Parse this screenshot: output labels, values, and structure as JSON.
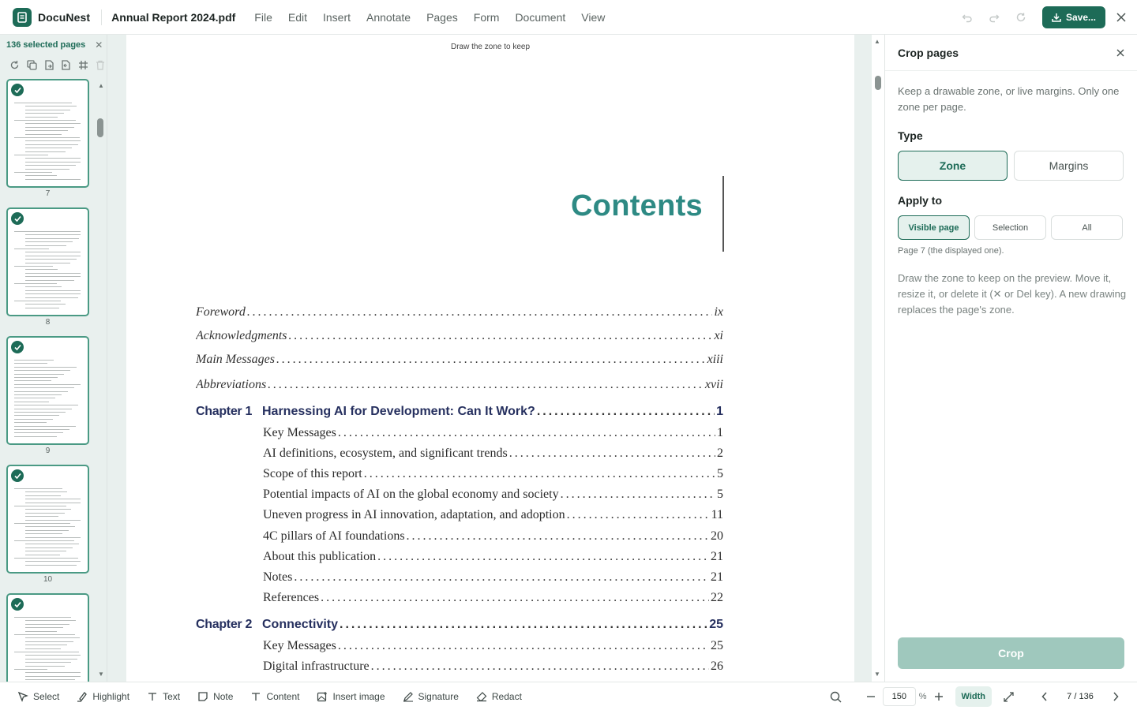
{
  "app": {
    "name": "DocuNest",
    "filename": "Annual Report 2024.pdf"
  },
  "menu": [
    "File",
    "Edit",
    "Insert",
    "Annotate",
    "Pages",
    "Form",
    "Document",
    "View"
  ],
  "toolbar": {
    "save_label": "Save..."
  },
  "sidebar": {
    "selected_label": "136 selected pages",
    "thumbnails": [
      {
        "page": "7"
      },
      {
        "page": "8"
      },
      {
        "page": "9"
      },
      {
        "page": "10"
      },
      {
        "page": ""
      }
    ]
  },
  "document": {
    "zone_hint": "Draw the zone to keep",
    "title": "Contents",
    "front_matter": [
      {
        "label": "Foreword",
        "page": "ix"
      },
      {
        "label": "Acknowledgments",
        "page": "xi"
      },
      {
        "label": "Main Messages",
        "page": "xiii"
      },
      {
        "label": "Abbreviations",
        "page": "xvii"
      }
    ],
    "chapters": [
      {
        "number": "Chapter 1",
        "title": "Harnessing AI for Development: Can It Work?",
        "page": "1",
        "sections": [
          {
            "label": "Key Messages",
            "page": "1"
          },
          {
            "label": "AI definitions, ecosystem, and significant trends",
            "page": "2"
          },
          {
            "label": "Scope of this report",
            "page": "5"
          },
          {
            "label": "Potential impacts of AI on the global economy and society",
            "page": "5"
          },
          {
            "label": "Uneven progress in AI innovation, adaptation, and adoption",
            "page": "11"
          },
          {
            "label": "4C pillars of AI foundations",
            "page": "20"
          },
          {
            "label": "About this publication",
            "page": "21"
          },
          {
            "label": "Notes",
            "page": "21"
          },
          {
            "label": "References",
            "page": "22"
          }
        ]
      },
      {
        "number": "Chapter 2",
        "title": "Connectivity",
        "page": "25",
        "sections": [
          {
            "label": "Key Messages",
            "page": "25"
          },
          {
            "label": "Digital infrastructure",
            "page": "26"
          }
        ]
      }
    ]
  },
  "panel": {
    "title": "Crop pages",
    "description": "Keep a drawable zone, or live margins. Only one zone per page.",
    "type_label": "Type",
    "type_options": [
      "Zone",
      "Margins"
    ],
    "type_selected": "Zone",
    "apply_label": "Apply to",
    "apply_options": [
      "Visible page",
      "Selection",
      "All"
    ],
    "apply_selected": "Visible page",
    "apply_note": "Page 7 (the displayed one).",
    "help": "Draw the zone to keep on the preview. Move it, resize it, or delete it (✕ or Del key). A new drawing replaces the page's zone.",
    "crop_label": "Crop"
  },
  "bottom": {
    "tools": [
      "Select",
      "Highlight",
      "Text",
      "Note",
      "Content",
      "Insert image",
      "Signature",
      "Redact"
    ],
    "zoom": "150",
    "zoom_unit": "%",
    "fit_label": "Width",
    "pager": "7 / 136"
  },
  "colors": {
    "accent": "#1d6b57",
    "accent_light": "#e5f1ed",
    "crop_disabled": "#9fc8bd",
    "contents_title": "#2e8a84",
    "chapter": "#26305f"
  }
}
